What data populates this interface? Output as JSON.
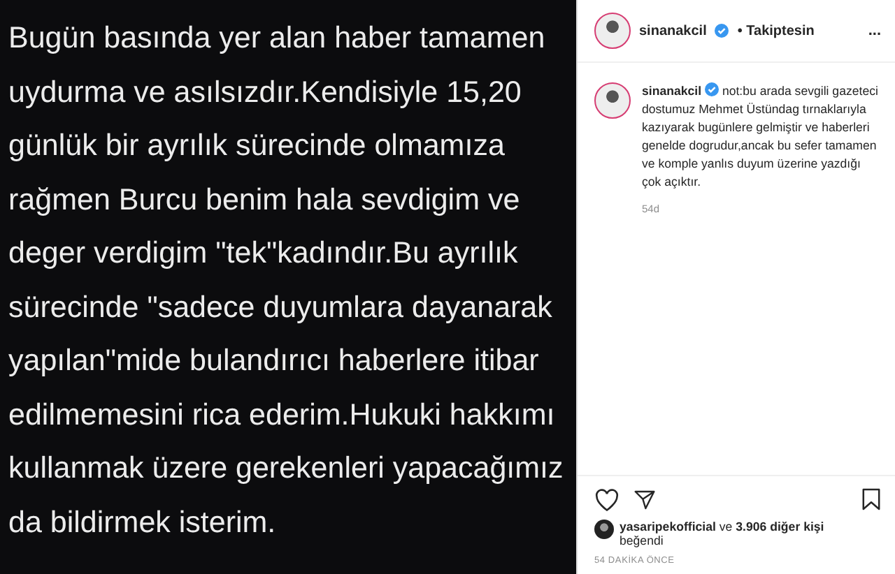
{
  "post_image": {
    "lines": [
      "Bugün basında yer alan haber tamamen",
      "uydurma ve asılsızdır.Kendisiyle 15,20",
      "günlük bir ayrılık sürecinde olmamıza",
      "rağmen Burcu benim hala sevdigim ve",
      "deger verdigim \"tek\"kadındır.Bu ayrılık",
      "sürecinde \"sadece duyumlara dayanarak",
      "yapılan\"mide bulandırıcı haberlere itibar",
      "edilmemesini rica ederim.Hukuki hakkımı",
      "kullanmak üzere gerekenleri yapacağımız",
      "da bildirmek isterim."
    ]
  },
  "header": {
    "username": "sinanakcil",
    "verified": true,
    "follow_status": "• Takiptesin",
    "more": "..."
  },
  "caption": {
    "username": "sinanakcil",
    "verified": true,
    "text": "not:bu arada sevgili gazeteci dostumuz Mehmet Üstündag tırnaklarıyla kazıyarak bugünlere gelmiştir ve haberleri genelde dogrudur,ancak bu sefer tamamen ve komple yanlıs duyum üzerine yazdığı çok açıktır.",
    "age": "54d"
  },
  "actions": {
    "liked": false,
    "saved": false
  },
  "likes": {
    "user": "yasaripekofficial",
    "rest": "ve",
    "count": "3.906 diğer kişi",
    "suffix": "beğendi"
  },
  "time": "54 DAKİKA ÖNCE"
}
